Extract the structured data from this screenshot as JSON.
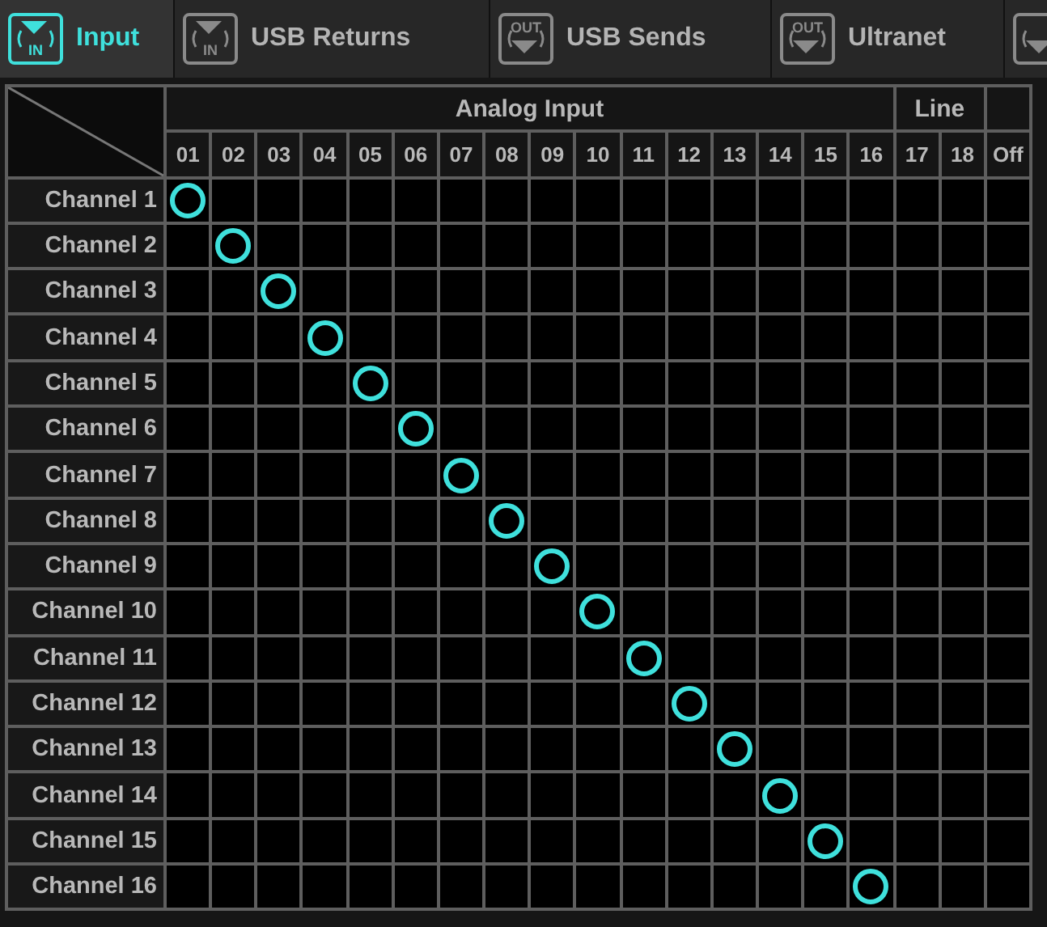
{
  "tabs": [
    {
      "label": "Input",
      "kind": "in",
      "icon_text": "IN",
      "selected": true
    },
    {
      "label": "USB Returns",
      "kind": "in",
      "icon_text": "IN",
      "selected": false
    },
    {
      "label": "USB Sends",
      "kind": "out",
      "icon_text": "OUT",
      "selected": false
    },
    {
      "label": "Ultranet",
      "kind": "out",
      "icon_text": "OUT",
      "selected": false
    },
    {
      "kind": "out",
      "selected": false
    }
  ],
  "matrix": {
    "groups": [
      {
        "label": "Analog Input",
        "columns": [
          "01",
          "02",
          "03",
          "04",
          "05",
          "06",
          "07",
          "08",
          "09",
          "10",
          "11",
          "12",
          "13",
          "14",
          "15",
          "16"
        ]
      },
      {
        "label": "Line",
        "columns": [
          "17",
          "18"
        ]
      },
      {
        "columns": [
          "Off"
        ]
      }
    ],
    "rows": [
      {
        "label": "Channel 1",
        "on": [
          true,
          false,
          false,
          false,
          false,
          false,
          false,
          false,
          false,
          false,
          false,
          false,
          false,
          false,
          false,
          false,
          false,
          false,
          false
        ]
      },
      {
        "label": "Channel 2",
        "on": [
          false,
          true,
          false,
          false,
          false,
          false,
          false,
          false,
          false,
          false,
          false,
          false,
          false,
          false,
          false,
          false,
          false,
          false,
          false
        ]
      },
      {
        "label": "Channel 3",
        "on": [
          false,
          false,
          true,
          false,
          false,
          false,
          false,
          false,
          false,
          false,
          false,
          false,
          false,
          false,
          false,
          false,
          false,
          false,
          false
        ]
      },
      {
        "label": "Channel 4",
        "on": [
          false,
          false,
          false,
          true,
          false,
          false,
          false,
          false,
          false,
          false,
          false,
          false,
          false,
          false,
          false,
          false,
          false,
          false,
          false
        ]
      },
      {
        "label": "Channel 5",
        "on": [
          false,
          false,
          false,
          false,
          true,
          false,
          false,
          false,
          false,
          false,
          false,
          false,
          false,
          false,
          false,
          false,
          false,
          false,
          false
        ]
      },
      {
        "label": "Channel 6",
        "on": [
          false,
          false,
          false,
          false,
          false,
          true,
          false,
          false,
          false,
          false,
          false,
          false,
          false,
          false,
          false,
          false,
          false,
          false,
          false
        ]
      },
      {
        "label": "Channel 7",
        "on": [
          false,
          false,
          false,
          false,
          false,
          false,
          true,
          false,
          false,
          false,
          false,
          false,
          false,
          false,
          false,
          false,
          false,
          false,
          false
        ]
      },
      {
        "label": "Channel 8",
        "on": [
          false,
          false,
          false,
          false,
          false,
          false,
          false,
          true,
          false,
          false,
          false,
          false,
          false,
          false,
          false,
          false,
          false,
          false,
          false
        ]
      },
      {
        "label": "Channel 9",
        "on": [
          false,
          false,
          false,
          false,
          false,
          false,
          false,
          false,
          true,
          false,
          false,
          false,
          false,
          false,
          false,
          false,
          false,
          false,
          false
        ]
      },
      {
        "label": "Channel 10",
        "on": [
          false,
          false,
          false,
          false,
          false,
          false,
          false,
          false,
          false,
          true,
          false,
          false,
          false,
          false,
          false,
          false,
          false,
          false,
          false
        ]
      },
      {
        "label": "Channel 11",
        "on": [
          false,
          false,
          false,
          false,
          false,
          false,
          false,
          false,
          false,
          false,
          true,
          false,
          false,
          false,
          false,
          false,
          false,
          false,
          false
        ]
      },
      {
        "label": "Channel 12",
        "on": [
          false,
          false,
          false,
          false,
          false,
          false,
          false,
          false,
          false,
          false,
          false,
          true,
          false,
          false,
          false,
          false,
          false,
          false,
          false
        ]
      },
      {
        "label": "Channel 13",
        "on": [
          false,
          false,
          false,
          false,
          false,
          false,
          false,
          false,
          false,
          false,
          false,
          false,
          true,
          false,
          false,
          false,
          false,
          false,
          false
        ]
      },
      {
        "label": "Channel 14",
        "on": [
          false,
          false,
          false,
          false,
          false,
          false,
          false,
          false,
          false,
          false,
          false,
          false,
          false,
          true,
          false,
          false,
          false,
          false,
          false
        ]
      },
      {
        "label": "Channel 15",
        "on": [
          false,
          false,
          false,
          false,
          false,
          false,
          false,
          false,
          false,
          false,
          false,
          false,
          false,
          false,
          true,
          false,
          false,
          false,
          false
        ]
      },
      {
        "label": "Channel 16",
        "on": [
          false,
          false,
          false,
          false,
          false,
          false,
          false,
          false,
          false,
          false,
          false,
          false,
          false,
          false,
          false,
          true,
          false,
          false,
          false
        ]
      }
    ]
  }
}
